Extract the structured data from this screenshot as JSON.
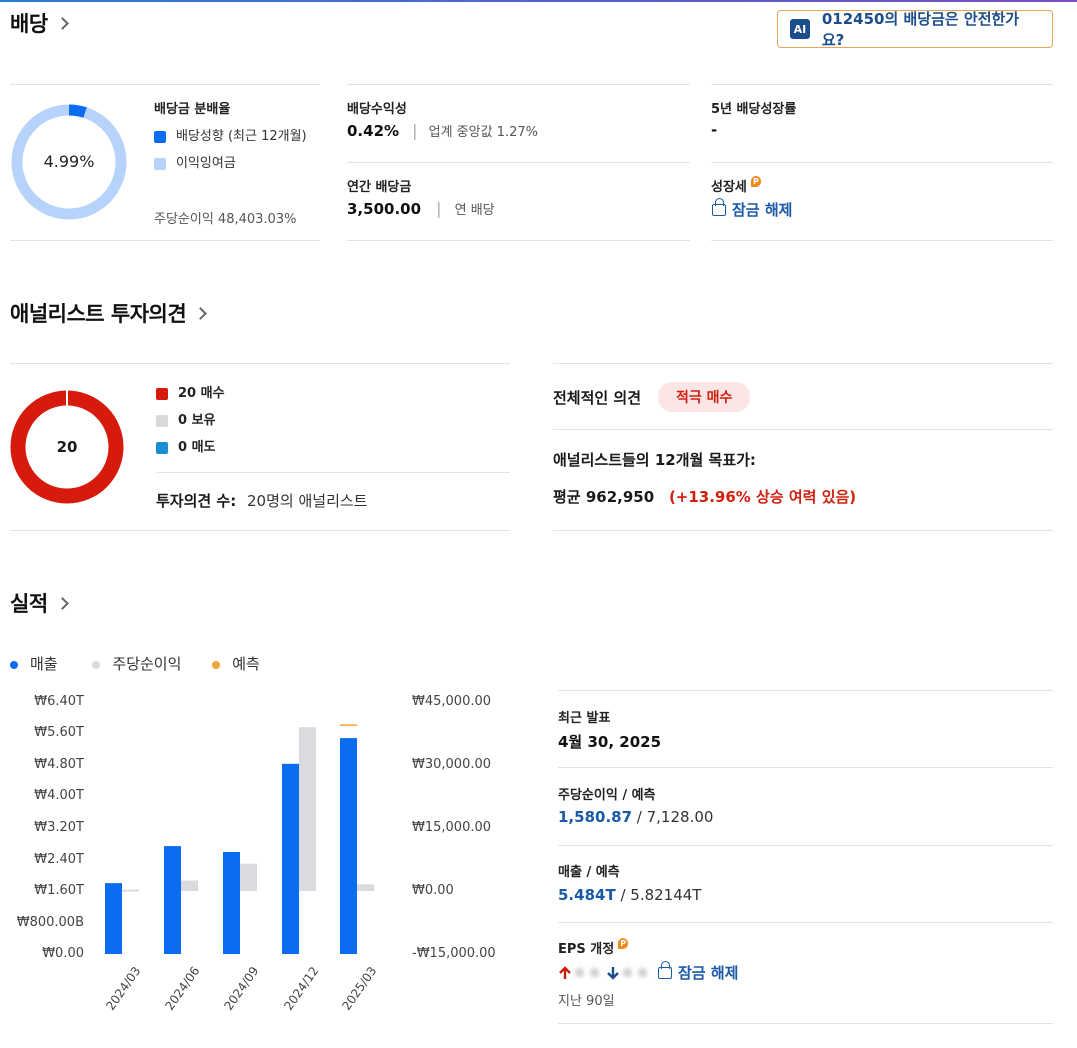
{
  "dividend": {
    "title": "배당",
    "ai_button": {
      "badge": "AI",
      "label": "012450의 배당금은 안전한가요?"
    },
    "payout_ratio": {
      "center_text": "4.99%",
      "value": 4.99,
      "title": "배당금 분배율",
      "legend_payout": "배당성향 (최근 12개월)",
      "legend_retained": "이익잉여금",
      "eps_text": "주당순이익 48,403.03%"
    },
    "yield": {
      "label": "배당수익성",
      "value": "0.42%",
      "sep": "|",
      "industry": "업계 중앙값 1.27%"
    },
    "annual": {
      "label": "연간 배당금",
      "value": "3,500.00",
      "sep": "|",
      "freq": "연 배당"
    },
    "growth5y": {
      "label": "5년 배당성장률",
      "value": "-"
    },
    "growth_stock": {
      "label": "성장세",
      "badge": "P",
      "unlock": "잠금 해제"
    },
    "colors": {
      "payout": "#0a6cf0",
      "retained": "#b7d3fb"
    }
  },
  "analyst": {
    "title": "애널리스트 투자의견",
    "center_text": "20",
    "buy": "20 매수",
    "hold": "0 보유",
    "sell": "0 매도",
    "count_label": "투자의견 수:",
    "count_value": "20명의 애널리스트",
    "overall_label": "전체적인 의견",
    "overall_value": "적극 매수",
    "target_label": "애널리스트들의 12개월 목표가:",
    "target_avg": "평균 962,950",
    "target_upside": "(+13.96% 상승 여력 있음)",
    "colors": {
      "buy": "#d61a0c",
      "hold": "#d9d9d9",
      "sell": "#1a8fd6"
    }
  },
  "earnings": {
    "title": "실적",
    "legend": {
      "revenue": "매출",
      "eps": "주당순이익",
      "forecast": "예측"
    },
    "latest_label": "최근 발표",
    "latest_value": "4월 30, 2025",
    "eps_label": "주당순이익 / 예측",
    "eps_actual": "1,580.87",
    "eps_forecast": " / 7,128.00",
    "rev_label": "매출 / 예측",
    "rev_actual": "5.484T",
    "rev_forecast": " / 5.82144T",
    "eps_rev_label": "EPS 개정",
    "eps_rev_badge": "P",
    "unlock": "잠금 해제",
    "period": "지난 90일",
    "colors": {
      "revenue": "#0a6cf0",
      "eps": "#d9dbde",
      "forecast": "#f2a53a",
      "up": "#c81e0e",
      "down": "#1b4d8c"
    }
  },
  "chart_data": {
    "type": "bar",
    "categories": [
      "2024/03",
      "2024/06",
      "2024/09",
      "2024/12",
      "2025/03"
    ],
    "left_ticks": [
      "₩6.40T",
      "₩5.60T",
      "₩4.80T",
      "₩4.00T",
      "₩3.20T",
      "₩2.40T",
      "₩1.60T",
      "₩800.00B",
      "₩0.00"
    ],
    "right_ticks": [
      "₩45,000.00",
      "₩30,000.00",
      "₩15,000.00",
      "₩0.00",
      "-₩15,000.00"
    ],
    "ylim_left": [
      0,
      6.4
    ],
    "ylim_right": [
      -15000,
      45000
    ],
    "series": [
      {
        "name": "매출",
        "axis": "left",
        "values": [
          1.8,
          2.74,
          2.59,
          4.83,
          5.484
        ]
      },
      {
        "name": "주당순이익",
        "axis": "right",
        "values": [
          330,
          2500,
          6500,
          39000,
          1580.87
        ]
      },
      {
        "name": "예측",
        "axis": "right",
        "values": [
          null,
          null,
          null,
          null,
          39500
        ]
      }
    ]
  }
}
